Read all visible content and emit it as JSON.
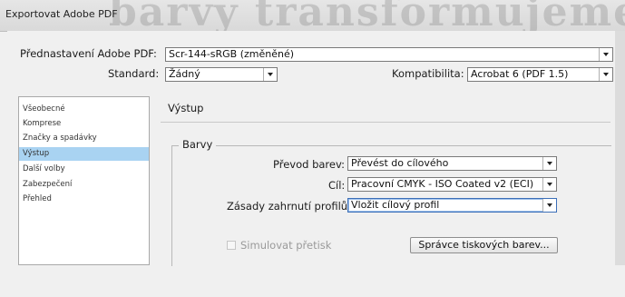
{
  "window": {
    "title": "Exportovat Adobe PDF",
    "background_headline": "barvy transformujeme do"
  },
  "preset": {
    "label": "Přednastavení Adobe PDF:",
    "value": "Scr-144-sRGB (změněné)"
  },
  "standard": {
    "label": "Standard:",
    "value": "Žádný"
  },
  "compatibility": {
    "label": "Kompatibilita:",
    "value": "Acrobat 6 (PDF 1.5)"
  },
  "sidebar": {
    "items": [
      {
        "label": "Všeobecné",
        "active": false
      },
      {
        "label": "Komprese",
        "active": false
      },
      {
        "label": "Značky a spadávky",
        "active": false
      },
      {
        "label": "Výstup",
        "active": true
      },
      {
        "label": "Další volby",
        "active": false
      },
      {
        "label": "Zabezpečení",
        "active": false
      },
      {
        "label": "Přehled",
        "active": false
      }
    ]
  },
  "panel": {
    "title": "Výstup",
    "group_title": "Barvy",
    "color_conversion": {
      "label": "Převod barev:",
      "value": "Převést do cílového"
    },
    "destination": {
      "label": "Cíl:",
      "value": "Pracovní CMYK - ISO Coated v2 (ECI)"
    },
    "profile_policy": {
      "label": "Zásady zahrnutí profilů:",
      "value": "Vložit cílový profil"
    },
    "simulate_overprint": {
      "label": "Simulovat přetisk",
      "checked": false,
      "enabled": false
    },
    "ink_manager_button": "Správce tiskových barev..."
  },
  "colors": {
    "selection": "#a9d3f2",
    "focus": "#3c6fb8"
  }
}
